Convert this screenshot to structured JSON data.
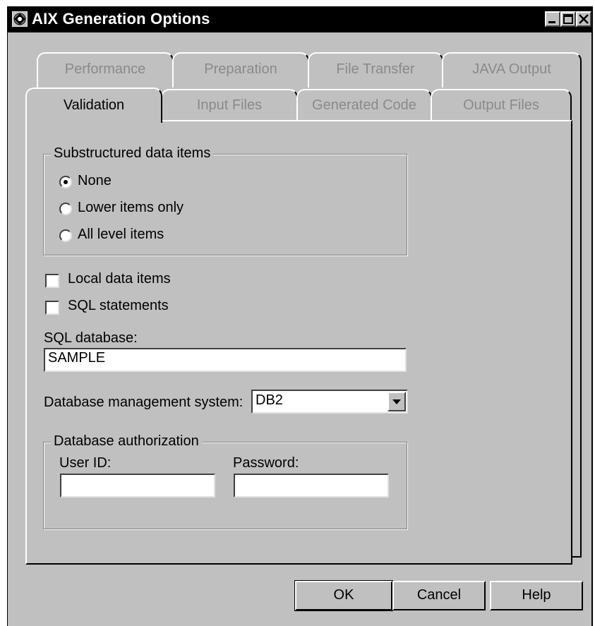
{
  "window": {
    "title": "AIX Generation Options"
  },
  "tabs": {
    "row_back": [
      "Performance",
      "Preparation",
      "File Transfer",
      "JAVA Output"
    ],
    "row_front": [
      "Validation",
      "Input Files",
      "Generated Code",
      "Output Files"
    ],
    "active": "Validation"
  },
  "substructured": {
    "legend": "Substructured data items",
    "options": [
      "None",
      "Lower items only",
      "All level items"
    ],
    "selected": "None"
  },
  "checks": {
    "local_data": {
      "label": "Local data items",
      "checked": false
    },
    "sql_statements": {
      "label": "SQL statements",
      "checked": false
    }
  },
  "sql_database": {
    "label": "SQL database:",
    "value": "SAMPLE"
  },
  "dbms": {
    "label": "Database management system:",
    "value": "DB2"
  },
  "auth": {
    "legend": "Database authorization",
    "user_label": "User ID:",
    "user_value": "",
    "password_label": "Password:",
    "password_value": ""
  },
  "buttons": {
    "ok": "OK",
    "cancel": "Cancel",
    "help": "Help"
  }
}
